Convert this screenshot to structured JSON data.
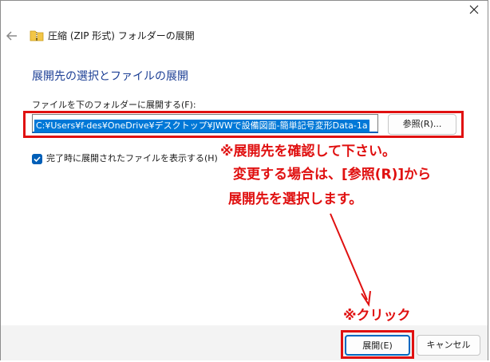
{
  "window": {
    "title": "圧縮 (ZIP 形式) フォルダーの展開"
  },
  "main": {
    "section_title": "展開先の選択とファイルの展開",
    "path_label": "ファイルを下のフォルダーに展開する(F):",
    "path_value": "C:¥Users¥f-des¥OneDrive¥デスクトップ¥JWWで設備図面-簡単記号変形Data-1a",
    "browse_label": "参照(R)...",
    "show_files_label": "完了時に展開されたファイルを表示する(H)",
    "show_files_checked": true
  },
  "footer": {
    "extract_label": "展開(E)",
    "cancel_label": "キャンセル"
  },
  "annotations": {
    "note_line1": "※展開先を確認して下さい。",
    "note_line2": "変更する場合は、[参照(R)]から",
    "note_line3": "展開先を選択します。",
    "click_note": "※クリック",
    "color": "#e01010"
  },
  "colors": {
    "accent": "#005fb8",
    "title_blue": "#1c3f95",
    "selection": "#0078d7"
  },
  "icons": {
    "back": "back-arrow-icon",
    "folder": "zip-folder-icon",
    "close": "close-icon",
    "check": "checkmark-icon"
  }
}
